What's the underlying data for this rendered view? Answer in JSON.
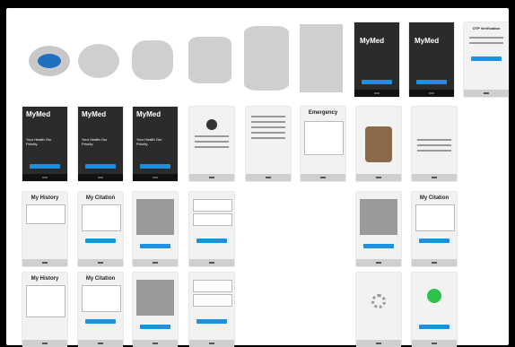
{
  "row1": {
    "splash_shapes": [
      "oval",
      "ellipse",
      "barrel",
      "cylinder",
      "tall-cylinder",
      "rectangle"
    ],
    "brand_logo": "MyMed",
    "otp_title": "OTP Verification"
  },
  "row2": {
    "brand_logo": "MyMed",
    "dark_headlines": [
      "Your Health Our Priority",
      "Your Health Our Priority",
      "Your Health Our Priority"
    ],
    "emergency_title": "Emergency"
  },
  "history_title": "My History",
  "citation_title": "My Citation",
  "colors": {
    "accent": "#1e90e0",
    "dark": "#2b2b2b",
    "frame": "#dcdcdc",
    "placeholder": "#cfcfcf"
  }
}
